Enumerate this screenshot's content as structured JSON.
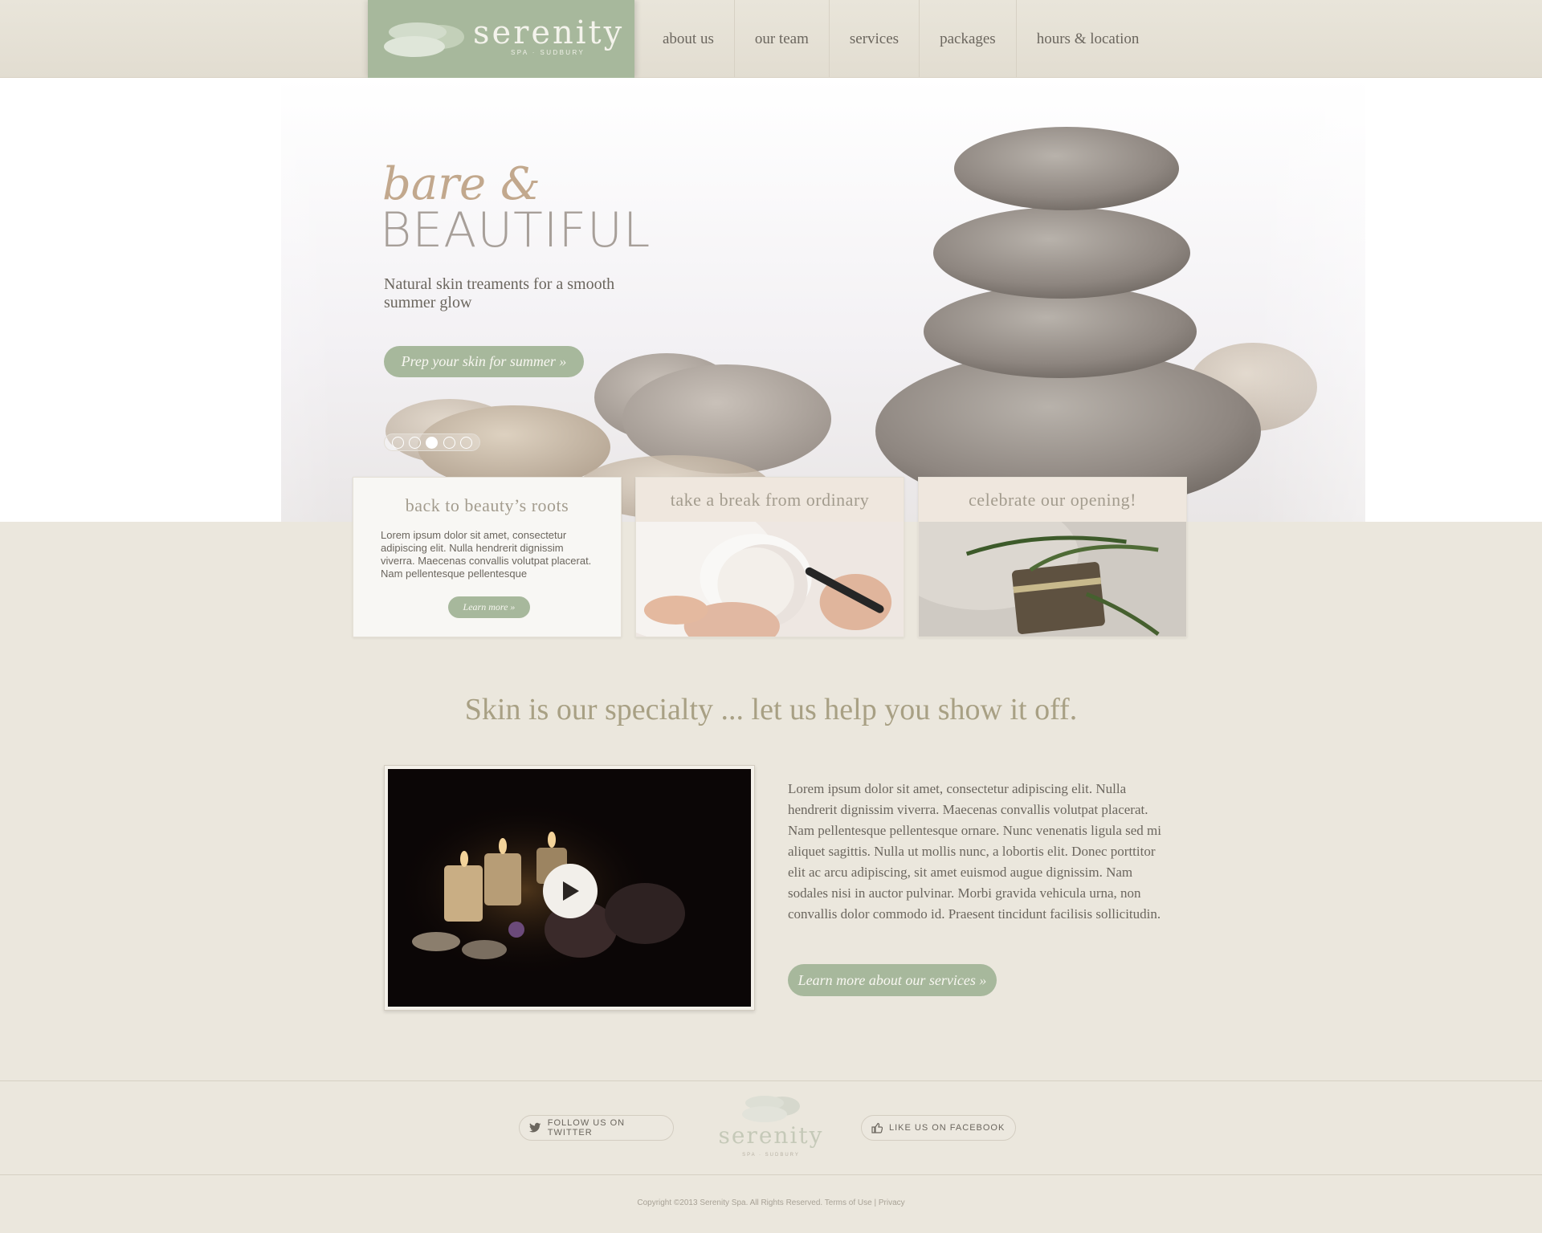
{
  "brand": {
    "name": "serenity",
    "tagline": "SPA · SUDBURY"
  },
  "nav": {
    "items": [
      {
        "label": "about us"
      },
      {
        "label": "our team"
      },
      {
        "label": "services"
      },
      {
        "label": "packages"
      },
      {
        "label": "hours & location"
      }
    ]
  },
  "hero": {
    "title_italic": "bare &",
    "title_caps": "BEAUTIFUL",
    "subtitle": "Natural skin treaments for a smooth summer glow",
    "button_label": "Prep your skin for summer »",
    "slides_count": 5,
    "active_slide": 3
  },
  "cards": [
    {
      "title": "back to beauty’s roots",
      "text": "Lorem ipsum dolor sit amet, consectetur adipiscing elit. Nulla hendrerit dignissim viverra. Maecenas convallis volutpat placerat. Nam pellentesque pellentesque",
      "button_label": "Learn more »"
    },
    {
      "title": "take a break from ordinary"
    },
    {
      "title": "celebrate our opening!"
    }
  ],
  "main": {
    "tagline": "Skin is our specialty ... let us help you show it off.",
    "body": "Lorem ipsum dolor sit amet, consectetur adipiscing elit. Nulla hendrerit dignissim viverra. Maecenas convallis volutpat placerat. Nam pellentesque pellentesque ornare. Nunc venenatis ligula sed mi aliquet sagittis. Nulla ut mollis nunc, a lobortis elit. Donec porttitor elit ac arcu adipiscing, sit amet euismod augue dignissim. Nam sodales nisi in auctor pulvinar. Morbi gravida vehicula urna, non convallis dolor commodo id. Praesent tincidunt facilisis sollicitudin.",
    "button_label": "Learn more about our services »"
  },
  "footer": {
    "twitter_label": "FOLLOW US ON TWITTER",
    "facebook_label": "LIKE US ON FACEBOOK",
    "brand_name": "serenity",
    "brand_sub": "SPA · SUDBURY",
    "copyright": "Copyright ©2013 Serenity Spa.  All Rights Reserved.",
    "terms": "Terms of Use",
    "separator": "|",
    "privacy": "Privacy"
  },
  "colors": {
    "accent_green": "#a7b89c",
    "background": "#ebe7dd",
    "hero_title_tan": "#c2a88d",
    "heading_olive": "#a8a084"
  },
  "icons": [
    "twitter-bird-icon",
    "thumbs-up-icon",
    "play-icon",
    "stones-logo-icon"
  ]
}
